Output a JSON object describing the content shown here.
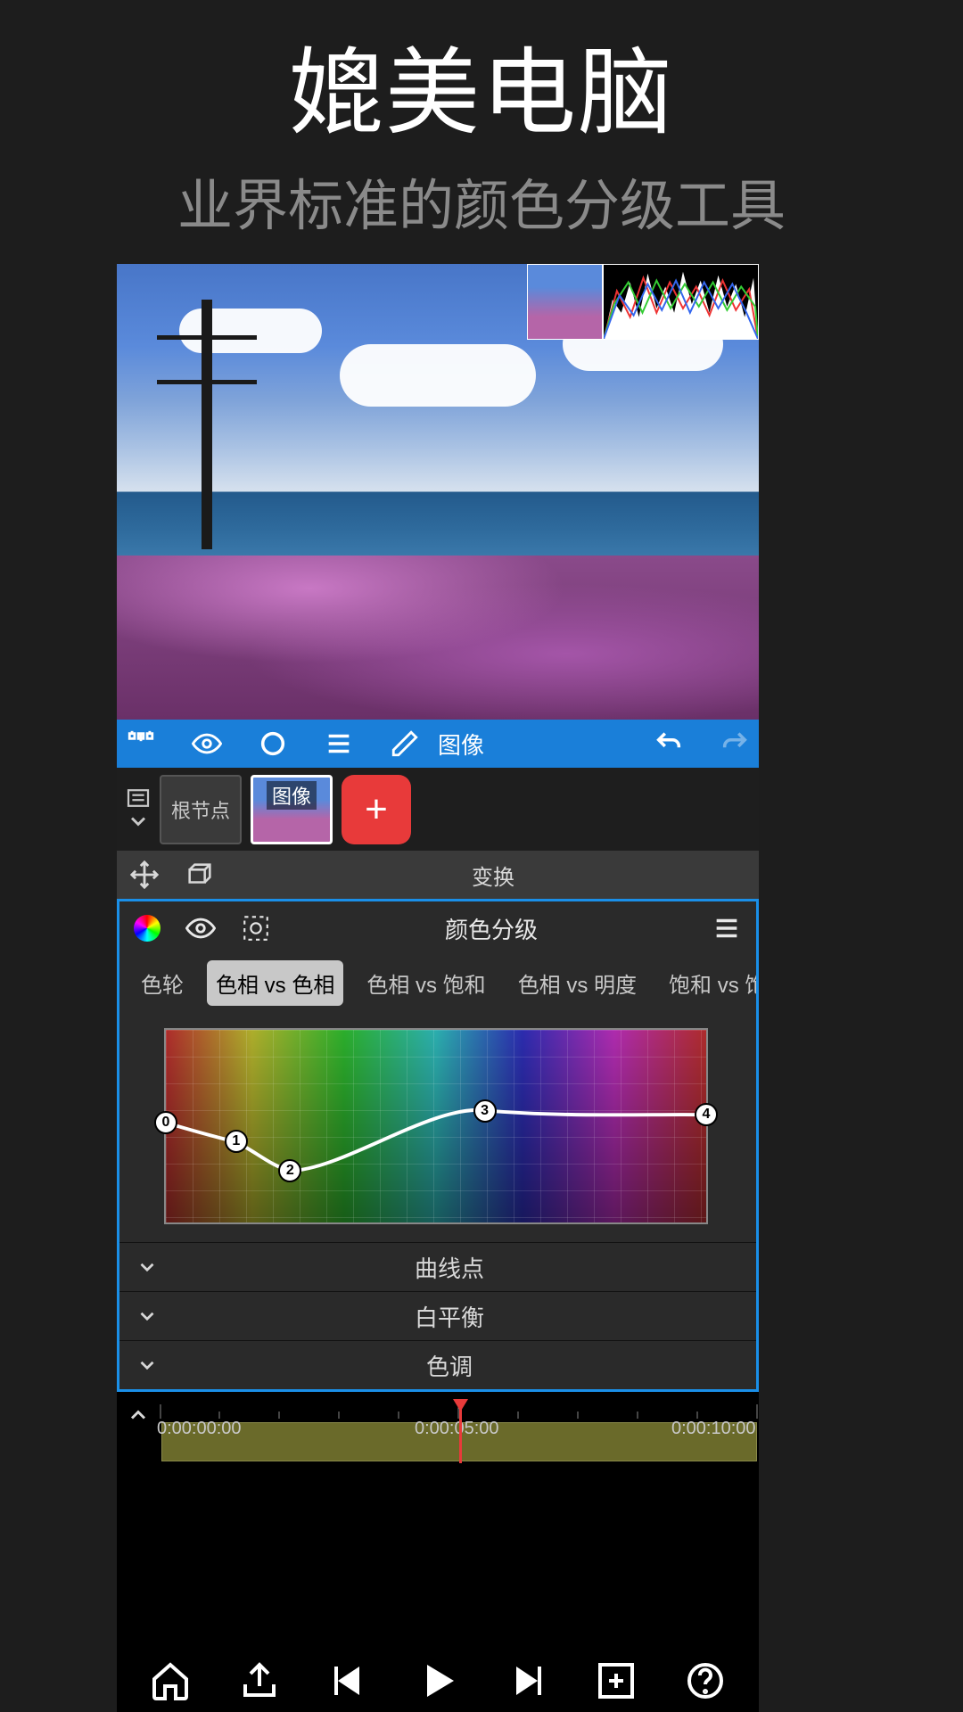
{
  "header": {
    "title": "媲美电脑",
    "subtitle": "业界标准的颜色分级工具"
  },
  "toolbar": {
    "crumb": "图像"
  },
  "nodes": {
    "root_label": "根节点",
    "image_label": "图像"
  },
  "transform": {
    "title": "变换"
  },
  "color_panel": {
    "title": "颜色分级",
    "tabs": [
      "色轮",
      "色相 vs 色相",
      "色相 vs 饱和",
      "色相 vs 明度",
      "饱和 vs 饱和"
    ],
    "active_tab_index": 1,
    "curve_points": [
      {
        "id": 0,
        "x": 0.0,
        "y": 0.48
      },
      {
        "id": 1,
        "x": 0.13,
        "y": 0.58
      },
      {
        "id": 2,
        "x": 0.23,
        "y": 0.73
      },
      {
        "id": 3,
        "x": 0.59,
        "y": 0.42
      },
      {
        "id": 4,
        "x": 1.0,
        "y": 0.44
      }
    ],
    "accordions": [
      "曲线点",
      "白平衡",
      "色调"
    ]
  },
  "timeline": {
    "marks": [
      "0:00:00:00",
      "0:00:05:00",
      "0:00:10:00"
    ]
  }
}
